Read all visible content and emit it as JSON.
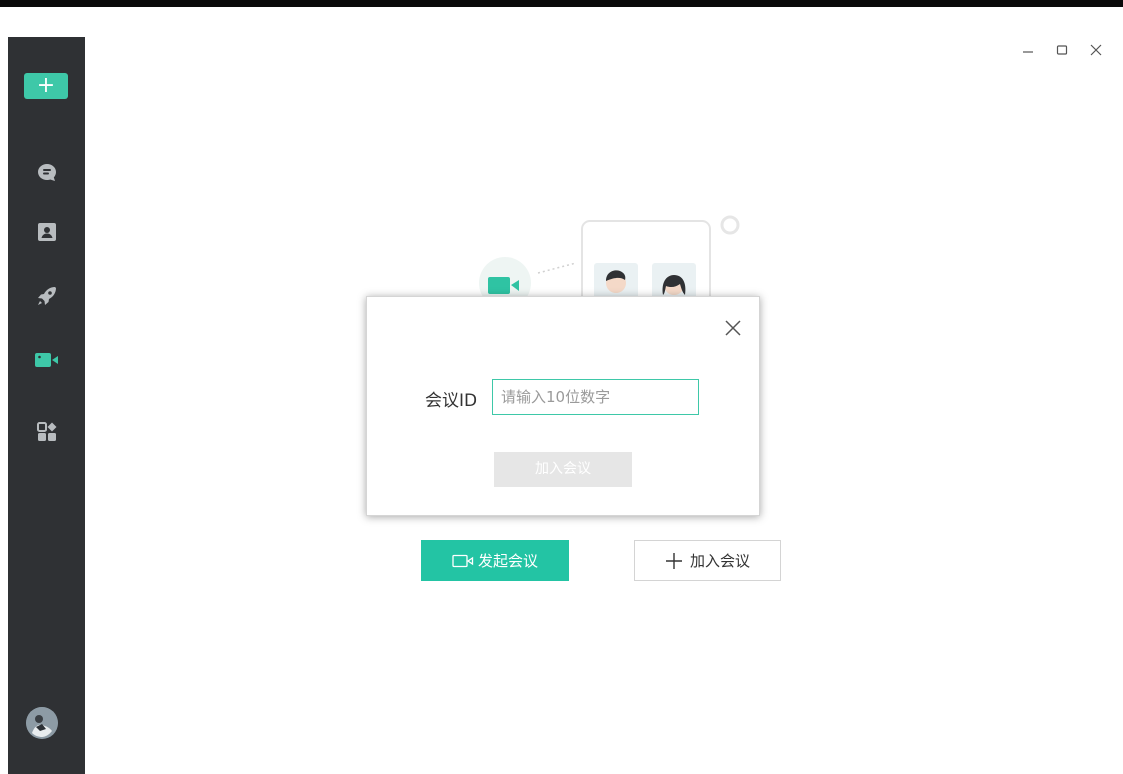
{
  "sidebar": {
    "add_icon": "+",
    "items": [
      {
        "icon": "chat-bubble-icon"
      },
      {
        "icon": "contact-card-icon"
      },
      {
        "icon": "rocket-icon"
      },
      {
        "icon": "video-camera-icon"
      },
      {
        "icon": "apps-grid-icon"
      }
    ],
    "accent_color": "#3ec8a8"
  },
  "window_controls": {
    "minimize": "–",
    "maximize": "□",
    "close": "✕"
  },
  "dialog": {
    "close_icon": "✕",
    "meeting_id_label": "会议ID",
    "meeting_id_placeholder": "请输入10位数字",
    "meeting_id_value": "",
    "join_button_label": "加入会议"
  },
  "actions": {
    "start_meeting_label": "发起会议",
    "join_meeting_label": "加入会议",
    "start_color": "#23c4a4"
  }
}
